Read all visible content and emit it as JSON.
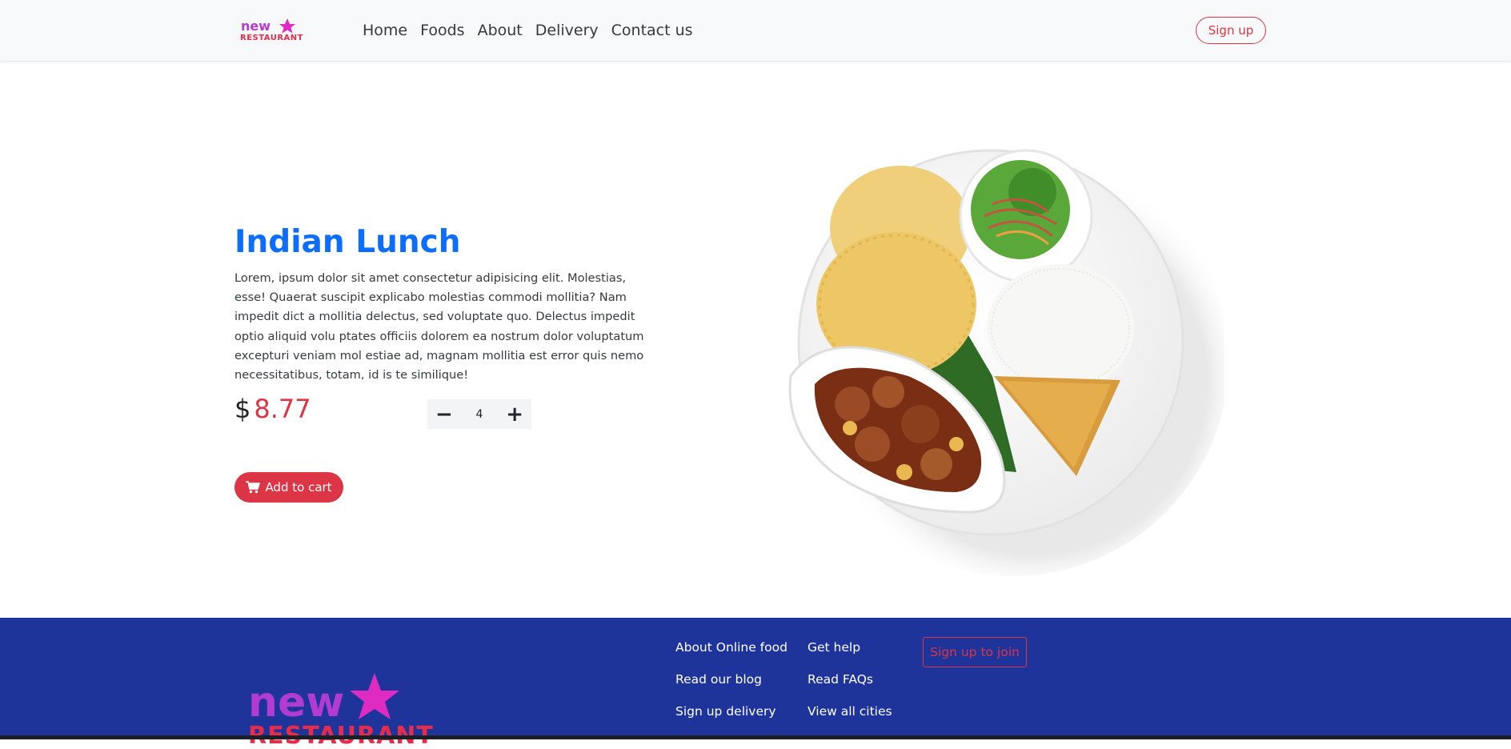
{
  "colors": {
    "accent": "#dc3545",
    "title_blue": "#0d6efd",
    "footer_bg": "#1f349a",
    "logo_pink": "#e02bc2",
    "logo_red": "#e62c4a"
  },
  "navbar": {
    "logo_text": "NEW RESTAURANT",
    "links": [
      "Home",
      "Foods",
      "About",
      "Delivery",
      "Contact us"
    ],
    "signup_label": "Sign up"
  },
  "product": {
    "title": "Indian Lunch",
    "description": " Lorem, ipsum dolor sit amet consectetur adipisicing elit. Molestias, esse! Quaerat suscipit explicabo molestias commodi mollitia? Nam impedit dict a mollitia delectus, sed voluptate quo. Delectus impedit optio aliquid volu ptates officiis dolorem ea nostrum dolor voluptatum excepturi veniam mol estiae ad, magnam mollitia est error quis nemo necessitatibus, totam, id is te similique!",
    "currency": "$",
    "price": "8.77",
    "quantity": "4",
    "minus_label": "−",
    "plus_label": "+",
    "add_to_cart_label": "Add to cart",
    "icons": {
      "cart": "cart-icon",
      "image": "food-plate-image"
    }
  },
  "footer": {
    "col1": [
      "About Online food",
      "Read our blog",
      "Sign up delivery"
    ],
    "col2": [
      "Get help",
      "Read FAQs",
      "View all cities"
    ],
    "signup_label": "Sign up to join",
    "logo_text": "NEW RESTAURANT"
  }
}
